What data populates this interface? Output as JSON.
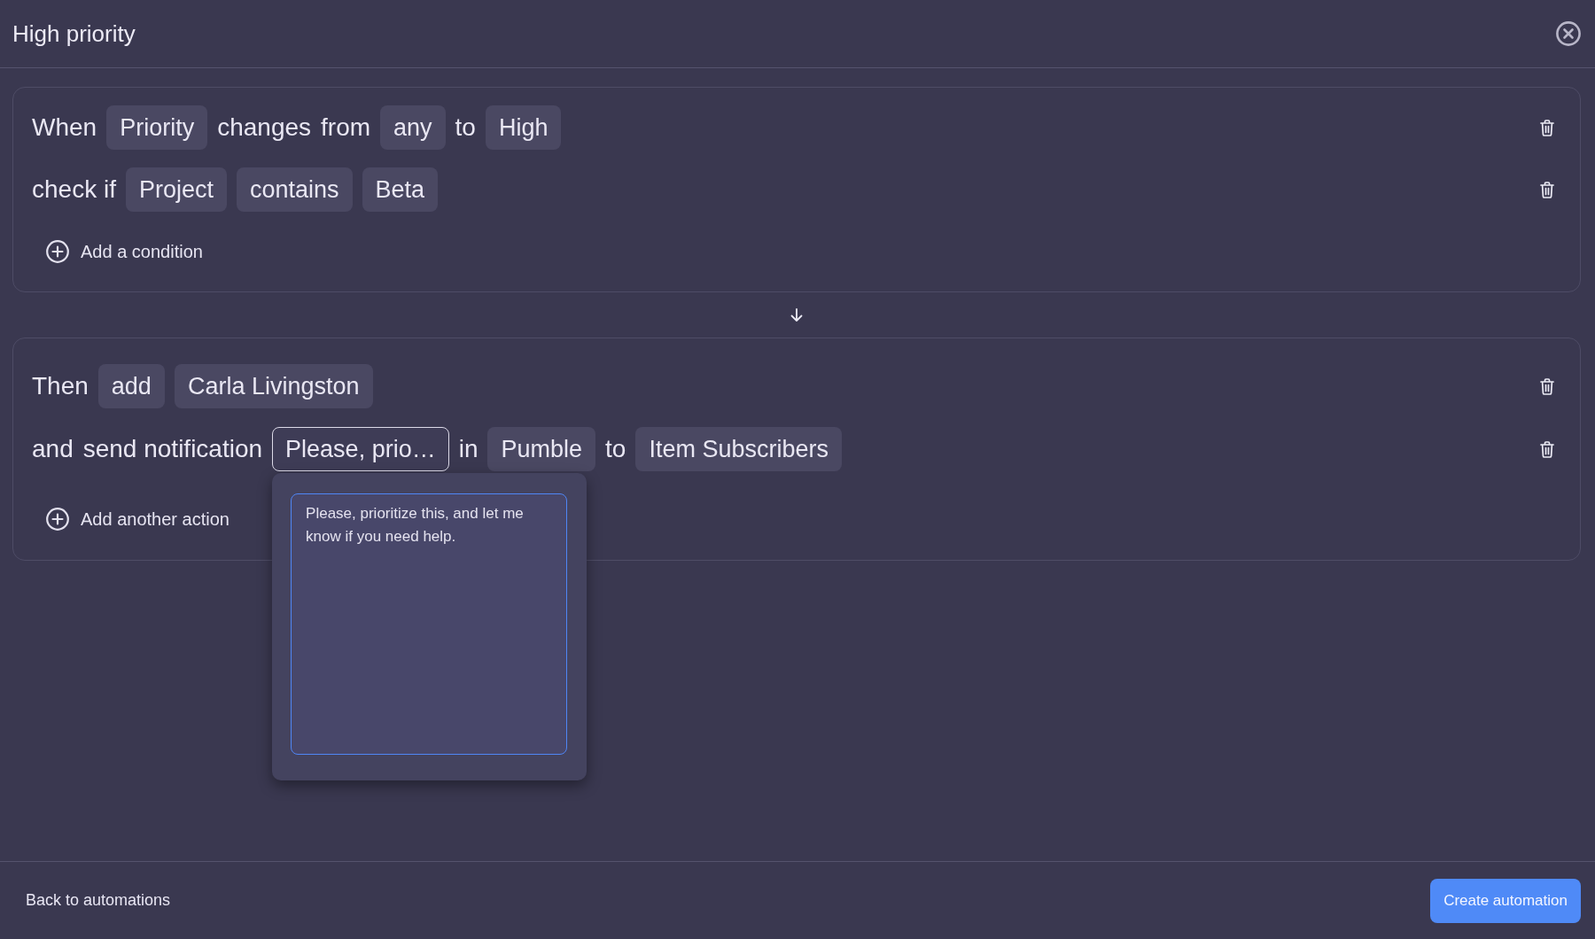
{
  "window": {
    "title": "High priority"
  },
  "blocks": [
    {
      "rows": [
        {
          "tokens": [
            {
              "kind": "word",
              "text": "When"
            },
            {
              "kind": "chip",
              "text": "Priority",
              "selected": false
            },
            {
              "kind": "word",
              "text": "changes"
            },
            {
              "kind": "word",
              "text": "from"
            },
            {
              "kind": "chip",
              "text": "any",
              "selected": false
            },
            {
              "kind": "word",
              "text": "to"
            },
            {
              "kind": "chip",
              "text": "High",
              "selected": false
            }
          ]
        },
        {
          "tokens": [
            {
              "kind": "word",
              "text": "check if"
            },
            {
              "kind": "chip",
              "text": "Project",
              "selected": false
            },
            {
              "kind": "chip",
              "text": "contains",
              "selected": false
            },
            {
              "kind": "chip",
              "text": "Beta",
              "selected": false
            }
          ]
        }
      ],
      "add_button": "Add a condition"
    },
    {
      "rows": [
        {
          "tokens": [
            {
              "kind": "word",
              "text": "Then"
            },
            {
              "kind": "chip",
              "text": "add",
              "selected": false
            },
            {
              "kind": "chip",
              "text": "Carla Livingston",
              "selected": false
            }
          ]
        },
        {
          "tokens": [
            {
              "kind": "word",
              "text": "and"
            },
            {
              "kind": "word",
              "text": "send notification"
            },
            {
              "kind": "chip",
              "text": "Please, prio…",
              "selected": true
            },
            {
              "kind": "word",
              "text": "in"
            },
            {
              "kind": "chip",
              "text": "Pumble",
              "selected": false
            },
            {
              "kind": "word",
              "text": "to"
            },
            {
              "kind": "chip",
              "text": "Item Subscribers",
              "selected": false
            }
          ]
        }
      ],
      "add_button": "Add another action"
    }
  ],
  "message_popover": {
    "value": "Please, prioritize this, and let me know if you need help."
  },
  "footer": {
    "back_link": "Back to automations",
    "create_button": "Create automation"
  }
}
